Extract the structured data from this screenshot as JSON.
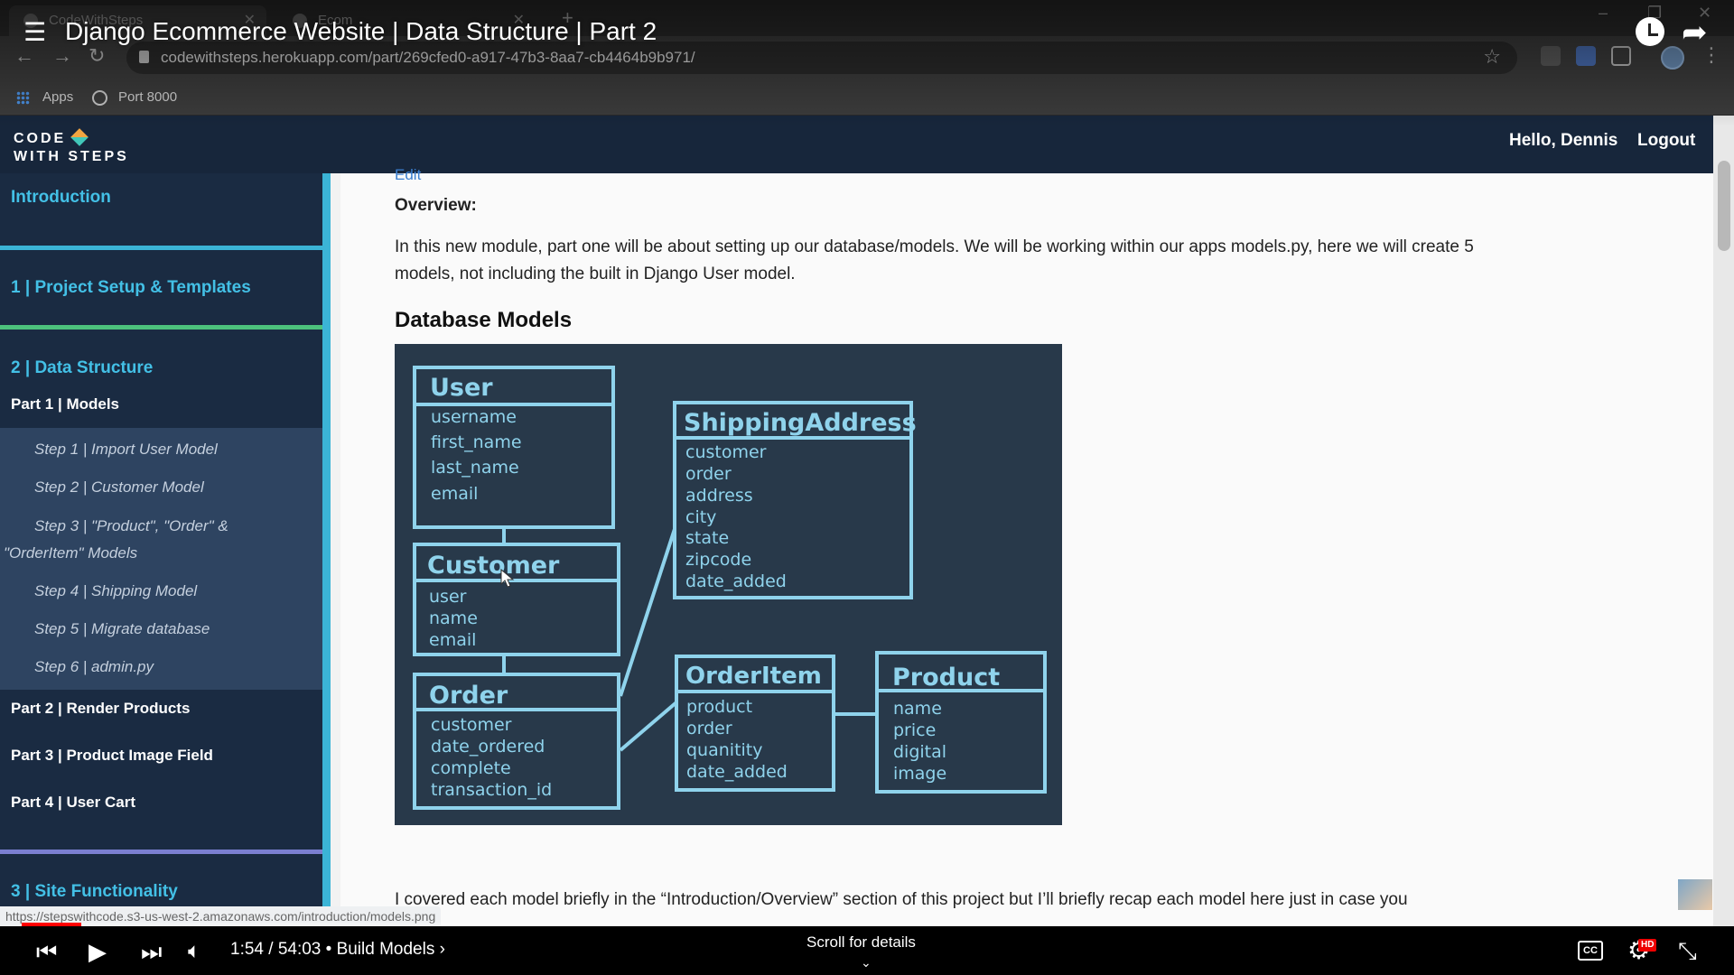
{
  "browser": {
    "tabs": [
      {
        "title": "CodeWithSteps"
      },
      {
        "title": "Ecom"
      }
    ],
    "url": "codewithsteps.herokuapp.com/part/269cfed0-a917-47b3-8aa7-cb4464b9b971/",
    "bookmarks": [
      {
        "label": "Apps"
      },
      {
        "label": "Port 8000"
      }
    ]
  },
  "video": {
    "title": "Django Ecommerce Website | Data Structure | Part 2",
    "time": "1:54 / 54:03 • Build Models ›",
    "progress_fraction": 0.035,
    "scroll_hint": "Scroll for details"
  },
  "site": {
    "logo_line1": "CODE",
    "logo_line2": "WITH STEPS",
    "greeting": "Hello, Dennis",
    "logout": "Logout"
  },
  "sidebar": {
    "intro": "Introduction",
    "section1": "1 | Project Setup & Templates",
    "section2": "2 | Data Structure",
    "part1": "Part 1 | Models",
    "steps": [
      "Step 1 | Import User Model",
      "Step 2 | Customer Model",
      "Step 3 | \"Product\", \"Order\" &",
      "\"OrderItem\" Models",
      "Step 4 | Shipping Model",
      "Step 5 | Migrate database",
      "Step 6 | admin.py"
    ],
    "part2": "Part 2 | Render Products",
    "part3": "Part 3 | Product Image Field",
    "part4": "Part 4 | User Cart",
    "section3": "3 | Site Functionality",
    "accent_colors": {
      "teal": "#3bb4d6",
      "green": "#4cc27c",
      "purple": "#7b7fd1"
    }
  },
  "content": {
    "edit": "Edit",
    "overview_label": "Overview:",
    "overview_text": "In this new module, part one will be about setting up our database/models. We will be working within our apps models.py, here we will create 5 models, not including the built in Django User model.",
    "db_heading": "Database Models",
    "recap_text": "I covered each model briefly in the “Introduction/Overview” section of this project but I’ll briefly recap each model here just in case you",
    "diagram": {
      "user": {
        "title": "User",
        "fields": [
          "username",
          "first_name",
          "last_name",
          "email"
        ]
      },
      "customer": {
        "title": "Customer",
        "fields": [
          "user",
          "name",
          "email"
        ]
      },
      "order": {
        "title": "Order",
        "fields": [
          "customer",
          "date_ordered",
          "complete",
          "transaction_id"
        ]
      },
      "shipping": {
        "title": "ShippingAddress",
        "fields": [
          "customer",
          "order",
          "address",
          "city",
          "state",
          "zipcode",
          "date_added"
        ]
      },
      "orderitem": {
        "title": "OrderItem",
        "fields": [
          "product",
          "order",
          "quanitity",
          "date_added"
        ]
      },
      "product": {
        "title": "Product",
        "fields": [
          "name",
          "price",
          "digital",
          "image"
        ]
      }
    }
  },
  "status_url": "https://stepswithcode.s3-us-west-2.amazonaws.com/introduction/models.png"
}
